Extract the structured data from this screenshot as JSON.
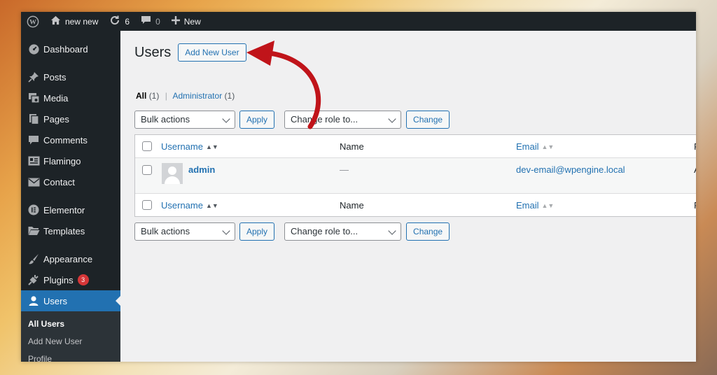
{
  "adminbar": {
    "site_name": "new new",
    "updates_count": "6",
    "comments_count": "0",
    "new_label": "New"
  },
  "sidebar": {
    "items": [
      {
        "label": "Dashboard",
        "icon": "dashboard-icon"
      },
      {
        "label": "Posts",
        "icon": "pin-icon"
      },
      {
        "label": "Media",
        "icon": "media-icon"
      },
      {
        "label": "Pages",
        "icon": "pages-icon"
      },
      {
        "label": "Comments",
        "icon": "comment-icon"
      },
      {
        "label": "Flamingo",
        "icon": "flamingo-icon"
      },
      {
        "label": "Contact",
        "icon": "mail-icon"
      },
      {
        "label": "Elementor",
        "icon": "elementor-icon"
      },
      {
        "label": "Templates",
        "icon": "folder-icon"
      },
      {
        "label": "Appearance",
        "icon": "brush-icon"
      },
      {
        "label": "Plugins",
        "icon": "plugin-icon",
        "badge": "3"
      },
      {
        "label": "Users",
        "icon": "user-icon"
      }
    ],
    "submenu": [
      "All Users",
      "Add New User",
      "Profile"
    ]
  },
  "page": {
    "title": "Users",
    "add_new_label": "Add New User"
  },
  "filters": {
    "all_label": "All",
    "all_count": "(1)",
    "admin_label": "Administrator",
    "admin_count": "(1)",
    "separator": "|"
  },
  "tablenav": {
    "bulk_actions": "Bulk actions",
    "apply": "Apply",
    "change_role": "Change role to...",
    "change": "Change"
  },
  "table": {
    "columns": [
      "Username",
      "Name",
      "Email",
      "R"
    ],
    "rows": [
      {
        "username": "admin",
        "name": "—",
        "email": "dev-email@wpengine.local",
        "role": "A"
      }
    ]
  },
  "colors": {
    "accent": "#2271b1",
    "adminbar": "#1d2327",
    "arrow": "#c0141a"
  }
}
